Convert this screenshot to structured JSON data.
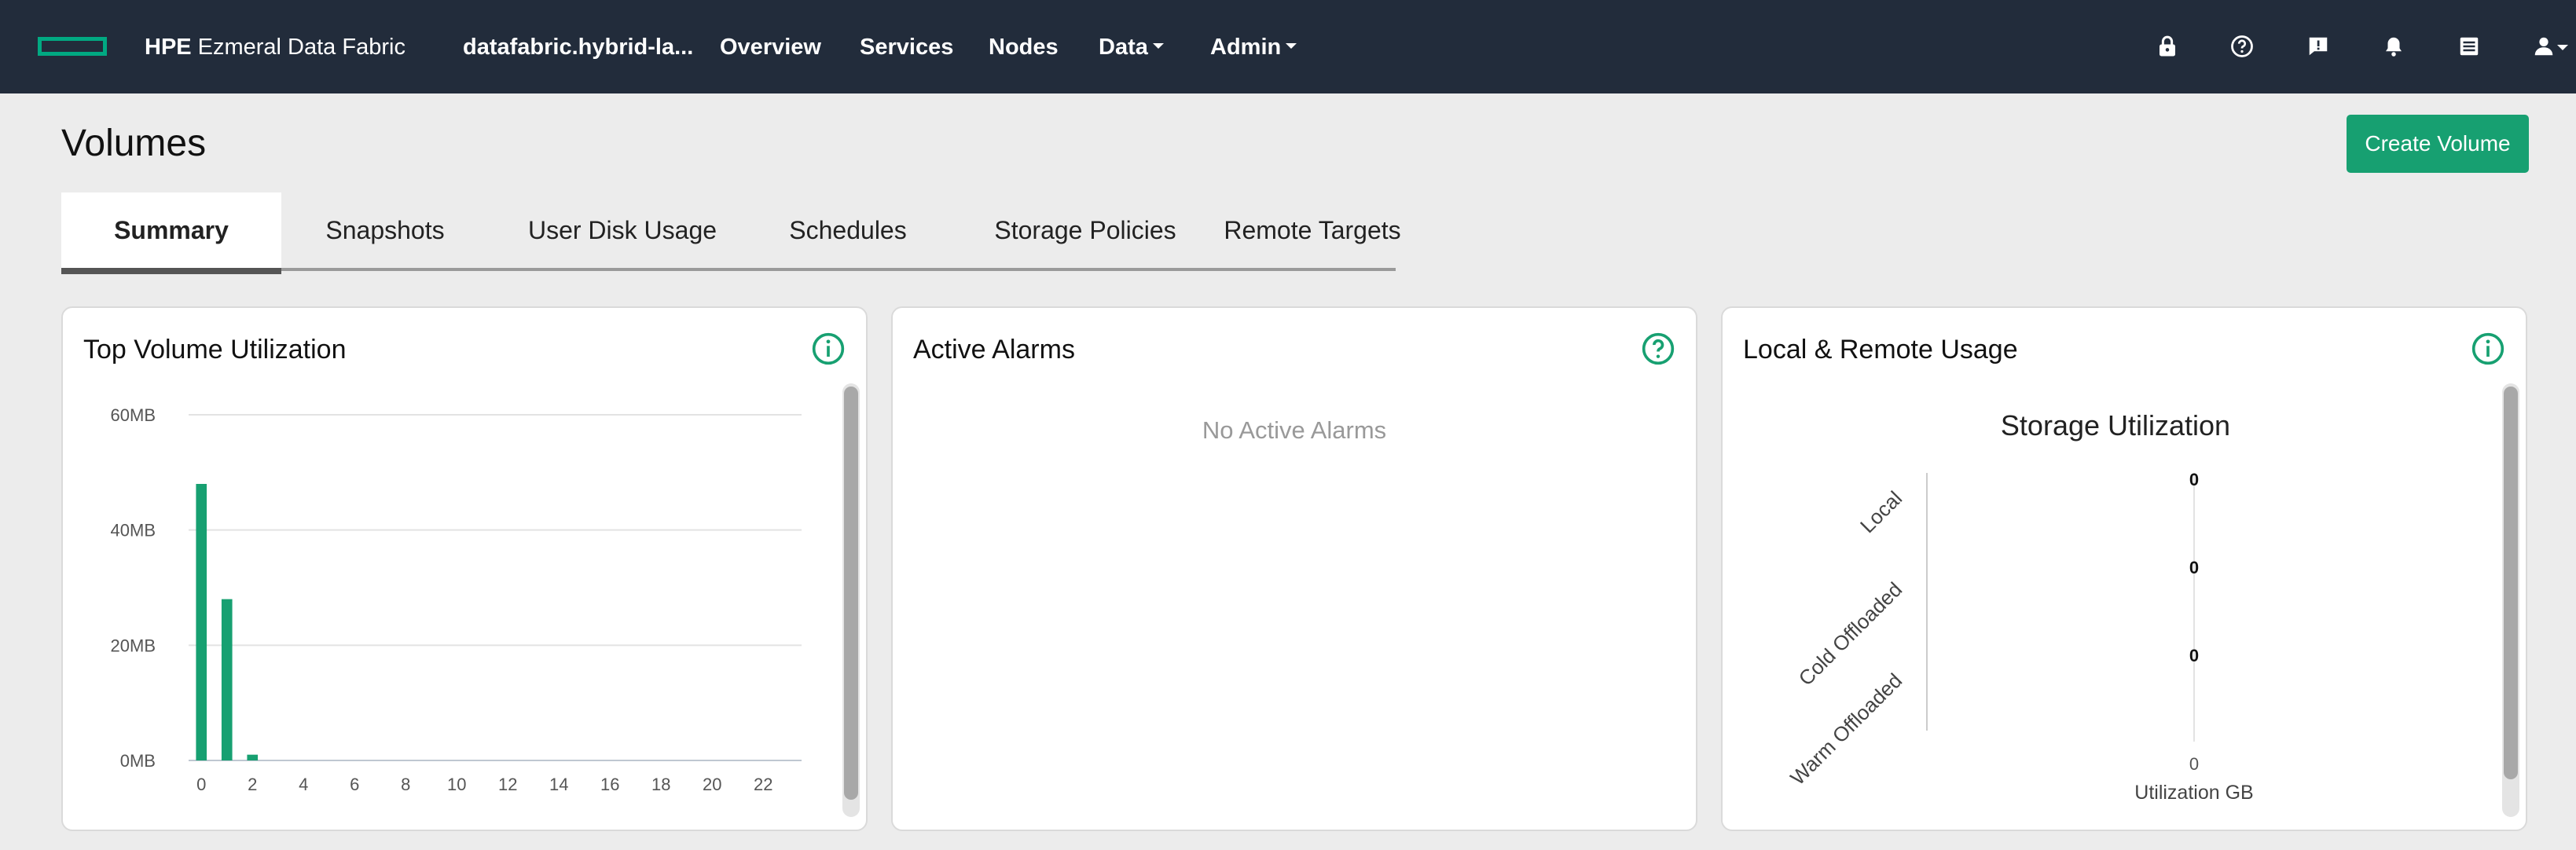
{
  "header": {
    "brand_bold": "HPE",
    "brand_name": "Ezmeral Data Fabric",
    "cluster": "datafabric.hybrid-la...",
    "nav": [
      "Overview",
      "Services",
      "Nodes",
      "Data",
      "Admin"
    ],
    "icons": [
      "lock-icon",
      "help-icon",
      "feedback-icon",
      "bell-icon",
      "document-icon",
      "user-icon"
    ],
    "accent": "#01a982"
  },
  "page": {
    "title": "Volumes",
    "create_button": "Create Volume",
    "tabs": [
      "Summary",
      "Snapshots",
      "User Disk Usage",
      "Schedules",
      "Storage Policies",
      "Remote Targets"
    ],
    "active_tab": "Summary"
  },
  "cards": {
    "top_volume": {
      "title": "Top Volume Utilization"
    },
    "alarms": {
      "title": "Active Alarms",
      "empty": "No Active Alarms"
    },
    "usage": {
      "title": "Local & Remote Usage"
    }
  },
  "chart_data": [
    {
      "type": "bar",
      "title": "",
      "xlabel": "",
      "ylabel": "",
      "x": [
        0,
        1,
        2,
        3,
        4,
        5,
        6,
        7,
        8,
        9,
        10,
        11,
        12,
        13,
        14,
        15,
        16,
        17,
        18,
        19,
        20,
        21,
        22,
        23
      ],
      "values": [
        48,
        28,
        1,
        0,
        0,
        0,
        0,
        0,
        0,
        0,
        0,
        0,
        0,
        0,
        0,
        0,
        0,
        0,
        0,
        0,
        0,
        0,
        0,
        0
      ],
      "unit": "MB",
      "ylim": [
        0,
        60
      ],
      "yticks": [
        "0MB",
        "20MB",
        "40MB",
        "60MB"
      ],
      "xticks": [
        "0",
        "2",
        "4",
        "6",
        "8",
        "10",
        "12",
        "14",
        "16",
        "18",
        "20",
        "22"
      ],
      "color": "#17a071",
      "grid": true
    },
    {
      "type": "bar",
      "orientation": "horizontal",
      "title": "Storage Utilization",
      "xlabel": "Utilization GB",
      "categories": [
        "Local",
        "Cold Offloaded",
        "Warm Offloaded"
      ],
      "values": [
        0,
        0,
        0
      ],
      "data_labels": [
        "0",
        "0",
        "0"
      ],
      "xticks": [
        "0"
      ]
    }
  ]
}
